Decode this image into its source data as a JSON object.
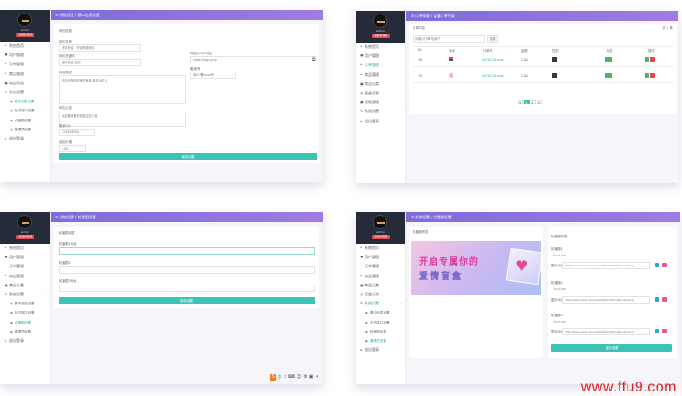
{
  "panels": [
    {
      "sidebar": {
        "username": "admin",
        "role": "超级管理员",
        "items": [
          {
            "icon": "•",
            "label": "系统首页",
            "sub": false,
            "active": false
          },
          {
            "icon": "♥",
            "label": "用户管理",
            "sub": false,
            "active": false
          },
          {
            "icon": "•",
            "label": "订单管理",
            "sub": false,
            "active": false
          },
          {
            "icon": "•",
            "label": "商品管理",
            "sub": false,
            "active": false
          },
          {
            "icon": "▣",
            "label": "商品分类",
            "sub": false,
            "active": false
          },
          {
            "icon": "✎",
            "label": "系统设置",
            "sub": false,
            "active": false,
            "arrow": "‹"
          },
          {
            "icon": "◈",
            "label": "基本信息设置",
            "sub": true,
            "active": true
          },
          {
            "icon": "◈",
            "label": "支付接口设置",
            "sub": true,
            "active": false
          },
          {
            "icon": "◈",
            "label": "轮播图设置",
            "sub": true,
            "active": false
          },
          {
            "icon": "◈",
            "label": "管理员设置",
            "sub": true,
            "active": false
          },
          {
            "icon": "⌂",
            "label": "退出登录",
            "sub": false,
            "active": false
          }
        ]
      },
      "header": "系统设置 / 基本信息设置",
      "form": {
        "section": "网站信息",
        "site_name_label": "网站名称",
        "site_name_value": "爱情盲盒 - 开启专属你的",
        "keywords_label": "网站关键词",
        "keywords_value": "爱情盲盒,交友",
        "desc_label": "网站描述",
        "desc_value": "开启专属你的爱情盲盒,遇见对的人",
        "notice_label": "网站公告",
        "notice_value": "欢迎使用爱情盲盒交友平台",
        "kefu_label": "客服QQ",
        "kefu_value": "123456789",
        "price_label": "抽取价格",
        "price_value": "1.00",
        "logo_label": "网站LOGO地址",
        "logo_value": "/static/logo.png",
        "record_label": "备案号",
        "record_value": "粤ICP备xxxx号",
        "save": "保存设置"
      }
    },
    {
      "sidebar": {
        "username": "admin",
        "role": "超级管理员",
        "items": [
          {
            "icon": "•",
            "label": "系统首页",
            "sub": false,
            "active": false
          },
          {
            "icon": "♥",
            "label": "用户管理",
            "sub": false,
            "active": false
          },
          {
            "icon": "•",
            "label": "订单管理",
            "sub": false,
            "active": true
          },
          {
            "icon": "•",
            "label": "商品管理",
            "sub": false,
            "active": false
          },
          {
            "icon": "▣",
            "label": "商品分类",
            "sub": false,
            "active": false
          },
          {
            "icon": "◎",
            "label": "盲盒记录",
            "sub": false,
            "active": false
          },
          {
            "icon": "▣",
            "label": "提现管理",
            "sub": false,
            "active": false
          },
          {
            "icon": "✎",
            "label": "系统设置",
            "sub": false,
            "active": false,
            "arrow": "‹"
          },
          {
            "icon": "⌂",
            "label": "退出登录",
            "sub": false,
            "active": false
          }
        ]
      },
      "header": "订单管理 / 盲盒订单列表",
      "toolbar": {
        "title": "订单列表",
        "search_placeholder": "请输入订单号/用户",
        "search_btn": "搜索",
        "right": "共 2 条"
      },
      "columns": [
        "ID",
        "头像",
        "订单号",
        "金额",
        "性别",
        "状态",
        "操作"
      ],
      "rows": [
        {
          "id": "16",
          "order": "20220101xxxx",
          "amount": "1.00",
          "gender": "男",
          "status": "已支付"
        },
        {
          "id": "15",
          "order": "20220101xxxx",
          "amount": "1.00",
          "gender": "女",
          "status": "已支付"
        }
      ],
      "pagination": [
        "«",
        "1",
        "»",
        "»|"
      ]
    },
    {
      "sidebar": {
        "username": "admin",
        "role": "超级管理员",
        "items": [
          {
            "icon": "•",
            "label": "系统首页",
            "sub": false,
            "active": false
          },
          {
            "icon": "♥",
            "label": "用户管理",
            "sub": false,
            "active": false
          },
          {
            "icon": "•",
            "label": "订单管理",
            "sub": false,
            "active": false
          },
          {
            "icon": "•",
            "label": "商品管理",
            "sub": false,
            "active": false
          },
          {
            "icon": "▣",
            "label": "商品分类",
            "sub": false,
            "active": false
          },
          {
            "icon": "✎",
            "label": "系统设置",
            "sub": false,
            "active": false,
            "arrow": "‹"
          },
          {
            "icon": "◈",
            "label": "基本信息设置",
            "sub": true,
            "active": false
          },
          {
            "icon": "◈",
            "label": "支付接口设置",
            "sub": true,
            "active": false
          },
          {
            "icon": "◈",
            "label": "轮播图设置",
            "sub": true,
            "active": true
          },
          {
            "icon": "◈",
            "label": "管理员设置",
            "sub": true,
            "active": false
          },
          {
            "icon": "⌂",
            "label": "退出登录",
            "sub": false,
            "active": false
          }
        ]
      },
      "header": "系统设置 / 轮播图设置",
      "form": {
        "section": "轮播图设置",
        "f1_label": "轮播图1地址",
        "f2_label": "轮播图2",
        "f3_label": "轮播图3地址",
        "save": "保存设置"
      },
      "taskbar": [
        "S",
        "中",
        "♪",
        "⌨",
        "☺",
        "⚙",
        "▣",
        "♦"
      ]
    },
    {
      "sidebar": {
        "username": "admin",
        "role": "超级管理员",
        "items": [
          {
            "icon": "•",
            "label": "系统首页",
            "sub": false,
            "active": false
          },
          {
            "icon": "♥",
            "label": "用户管理",
            "sub": false,
            "active": false
          },
          {
            "icon": "•",
            "label": "订单管理",
            "sub": false,
            "active": false
          },
          {
            "icon": "•",
            "label": "商品管理",
            "sub": false,
            "active": false
          },
          {
            "icon": "▣",
            "label": "商品分类",
            "sub": false,
            "active": false
          },
          {
            "icon": "◎",
            "label": "盲盒记录",
            "sub": false,
            "active": false
          },
          {
            "icon": "✎",
            "label": "系统设置",
            "sub": false,
            "active": true,
            "arrow": "‹"
          },
          {
            "icon": "◈",
            "label": "基本信息设置",
            "sub": true,
            "active": false
          },
          {
            "icon": "◈",
            "label": "支付接口设置",
            "sub": true,
            "active": false
          },
          {
            "icon": "◈",
            "label": "轮播图设置",
            "sub": true,
            "active": false
          },
          {
            "icon": "◈",
            "label": "管理员设置",
            "sub": true,
            "active": true
          },
          {
            "icon": "⌂",
            "label": "退出登录",
            "sub": false,
            "active": false
          }
        ]
      },
      "header": "系统设置 / 轮播图设置",
      "preview_title": "轮播图预览",
      "banner_line1": "开启专属你的",
      "banner_line2": "爱情盲盒",
      "right_title": "轮播图列表",
      "groups": [
        {
          "name": "轮播图1",
          "f1": "Youtube",
          "f2": "图片地址",
          "url": "http://www.xxxxx.com/upload/20220101/banner1.png"
        },
        {
          "name": "轮播图2",
          "f1": "Youtube",
          "f2": "图片地址",
          "url": "http://www.xxxxx.com/upload/20220101/banner2.png"
        },
        {
          "name": "轮播图3",
          "f1": "Youtube",
          "f2": "图片地址",
          "url": "http://www.xxxxx.com/upload/20220101/banner3.png"
        }
      ],
      "save": "保存设置"
    }
  ],
  "watermark": "www.ffu9.com",
  "colors": {
    "header": "#8a72dc",
    "teal": "#3cc3b5",
    "red": "#e2494d",
    "dark": "#262b3a",
    "green": "#49b869",
    "blue": "#2f9fe8",
    "pink": "#e9578f"
  }
}
